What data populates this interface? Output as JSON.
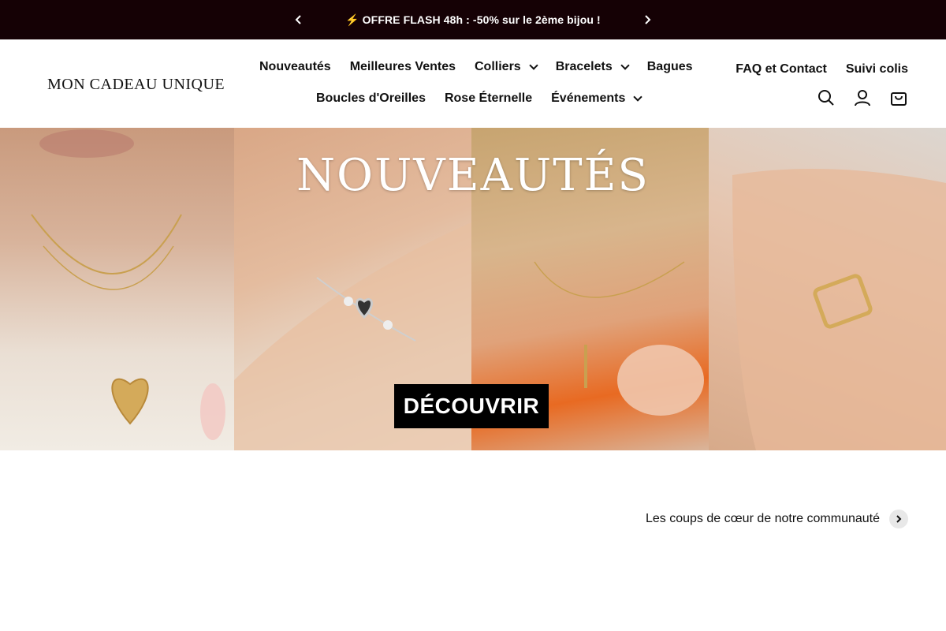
{
  "announcement": {
    "message": "⚡ OFFRE FLASH 48h : -50% sur le 2ème bijou !",
    "prev_glyph": "‹",
    "next_glyph": "›"
  },
  "header": {
    "logo": "MON CADEAU UNIQUE",
    "nav_row1": [
      {
        "label": "Nouveautés",
        "dropdown": false
      },
      {
        "label": "Meilleures Ventes",
        "dropdown": false
      },
      {
        "label": "Colliers",
        "dropdown": true
      },
      {
        "label": "Bracelets",
        "dropdown": true
      },
      {
        "label": "Bagues",
        "dropdown": false
      }
    ],
    "nav_row2": [
      {
        "label": "Boucles d'Oreilles",
        "dropdown": false
      },
      {
        "label": "Rose Éternelle",
        "dropdown": false
      },
      {
        "label": "Événements",
        "dropdown": true
      }
    ],
    "links": [
      "FAQ et Contact",
      "Suivi colis"
    ],
    "icons": [
      "search-icon",
      "account-icon",
      "cart-icon"
    ]
  },
  "hero": {
    "title": "NOUVEAUTÉS",
    "cta": "DÉCOUVRIR"
  },
  "community": {
    "label": "Les coups de cœur de notre communauté"
  },
  "colors": {
    "announcement_bg": "#150105",
    "cta_bg": "#000000",
    "text": "#111111"
  }
}
